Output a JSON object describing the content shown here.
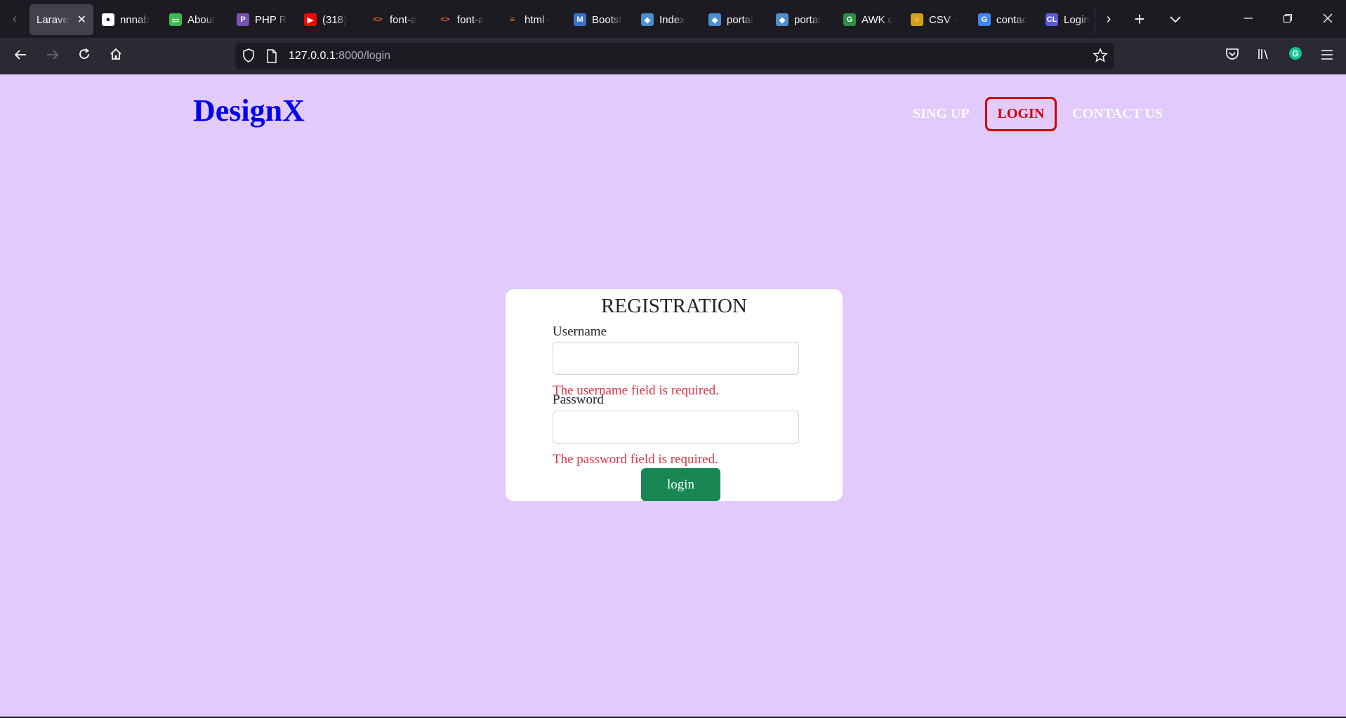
{
  "browser": {
    "tabs": [
      {
        "label": "Laravel",
        "icon": "laravel-icon",
        "color": "#42414d"
      },
      {
        "label": "nnnab",
        "icon": "github-icon",
        "color": "#ffffff"
      },
      {
        "label": "About",
        "icon": "book-icon",
        "color": "#3fb950"
      },
      {
        "label": "PHP R",
        "icon": "php-icon",
        "color": "#7952b3"
      },
      {
        "label": "(318)",
        "icon": "youtube-icon",
        "color": "#ff0000"
      },
      {
        "label": "font-a",
        "icon": "code-icon",
        "color": "#f06529"
      },
      {
        "label": "font-a",
        "icon": "code-icon",
        "color": "#f06529"
      },
      {
        "label": "html -",
        "icon": "stackoverflow-icon",
        "color": "#f48024"
      },
      {
        "label": "Bootst",
        "icon": "mdb-icon",
        "color": "#3b71ca"
      },
      {
        "label": "Index",
        "icon": "portal-icon",
        "color": "#4d8fcc"
      },
      {
        "label": "portal",
        "icon": "portal-icon",
        "color": "#4d8fcc"
      },
      {
        "label": "portal",
        "icon": "portal-icon",
        "color": "#4d8fcc"
      },
      {
        "label": "AWK c",
        "icon": "gfg-icon",
        "color": "#2f8d46"
      },
      {
        "label": "CSV -",
        "icon": "csv-icon",
        "color": "#d4a017"
      },
      {
        "label": "contac",
        "icon": "google-icon",
        "color": "#4285f4"
      },
      {
        "label": "Login",
        "icon": "cl-icon",
        "color": "#5b5bd6"
      }
    ],
    "url_host": "127.0.0.1",
    "url_rest": ":8000/login"
  },
  "site": {
    "brand": "DesignX",
    "nav": {
      "signup": "SING UP",
      "login": "LOGIN",
      "contact": "CONTACT US"
    }
  },
  "form": {
    "title": "REGISTRATION",
    "username_label": "Username",
    "username_value": "",
    "username_error": "The username field is required.",
    "password_label": "Password",
    "password_value": "",
    "password_error": "The password field is required.",
    "submit_label": "login"
  },
  "colors": {
    "page_bg": "#e2cafc",
    "brand": "#0000ee",
    "active_nav": "#d10000",
    "error": "#dc3545",
    "button": "#198754"
  }
}
